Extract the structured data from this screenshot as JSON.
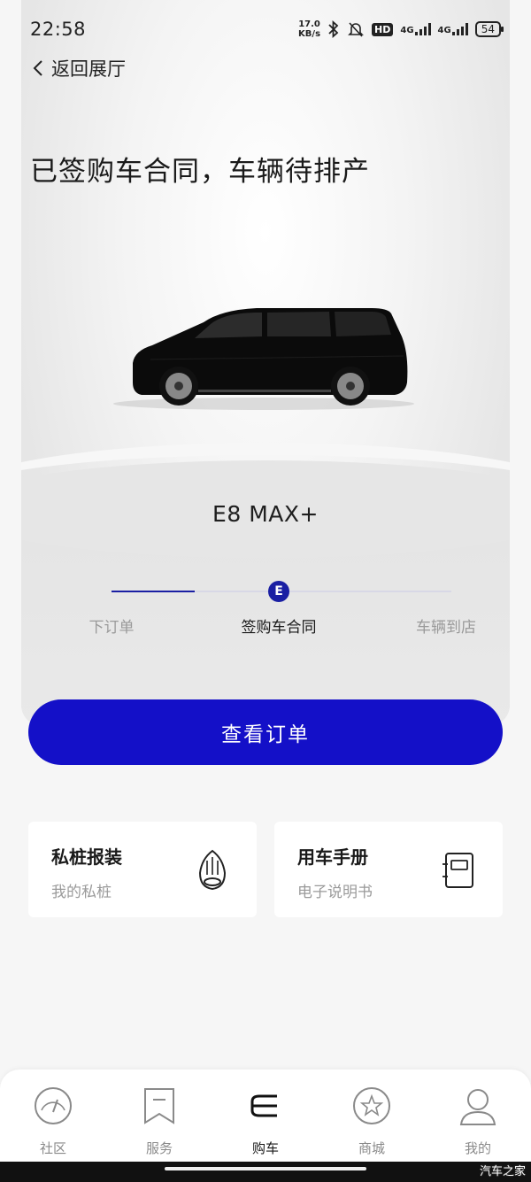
{
  "status_bar": {
    "time": "22:58",
    "net_speed_value": "17.0",
    "net_speed_unit": "KB/s",
    "hd_label": "HD",
    "signal1_label": "4G",
    "signal2_label": "4G",
    "battery": "54"
  },
  "header": {
    "back_label": "返回展厅",
    "headline": "已签购车合同，车辆待排产"
  },
  "vehicle": {
    "model_name": "E8 MAX+",
    "color": "#0b0b0b"
  },
  "progress": {
    "current_step_index": 1,
    "node_glyph": "E",
    "steps": [
      {
        "label": "下订单",
        "state": "done"
      },
      {
        "label": "签购车合同",
        "state": "current"
      },
      {
        "label": "车辆到店",
        "state": "pending"
      }
    ],
    "accent_color": "#1a1fa3"
  },
  "cta": {
    "label": "查看订单",
    "color": "#1410c8"
  },
  "cards": [
    {
      "title": "私桩报装",
      "subtitle": "我的私桩",
      "icon": "charger-icon"
    },
    {
      "title": "用车手册",
      "subtitle": "电子说明书",
      "icon": "manual-icon"
    }
  ],
  "tabbar": {
    "active_index": 2,
    "items": [
      {
        "label": "社区",
        "icon": "community-icon"
      },
      {
        "label": "服务",
        "icon": "service-icon"
      },
      {
        "label": "购车",
        "icon": "brand-e-icon"
      },
      {
        "label": "商城",
        "icon": "star-icon"
      },
      {
        "label": "我的",
        "icon": "profile-icon"
      }
    ]
  },
  "watermark": "汽车之家"
}
